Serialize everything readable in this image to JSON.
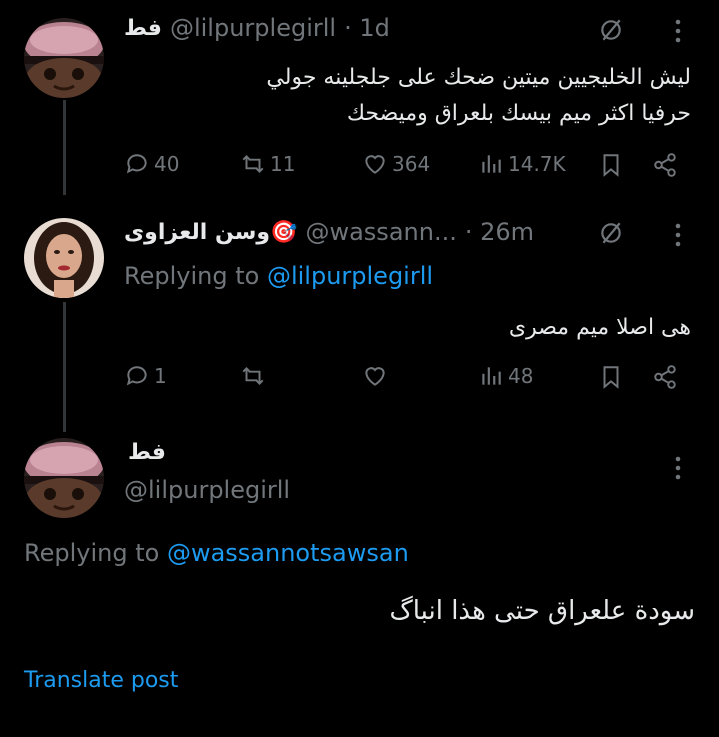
{
  "tweet1": {
    "name": "فط",
    "handle": "@lilpurplegirll",
    "time": "· 1d",
    "line1": "ليش الخليجيين ميتين ضحك على جلجلينه جولي",
    "line2": "حرفيا اكثر ميم بيسك بلعراق وميضحك",
    "replies": "40",
    "reposts": "11",
    "likes": "364",
    "views": "14.7K"
  },
  "tweet2": {
    "name": "وسن العزاوى🎯",
    "handle": "@wassann...",
    "time": "· 26m",
    "replying_prefix": "Replying to",
    "replying_to": "@lilpurplegirll",
    "text": "هى اصلا ميم مصرى",
    "replies": "1",
    "views": "48"
  },
  "tweet3": {
    "name": "فط",
    "handle": "@lilpurplegirll",
    "replying_prefix": "Replying to",
    "replying_to": "@wassannotsawsan",
    "text": "سودة علعراق حتى هذا انباگ",
    "translate": "Translate post"
  }
}
